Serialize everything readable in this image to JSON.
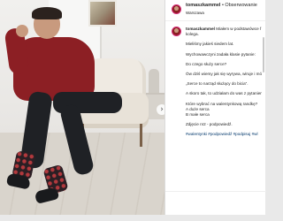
{
  "post": {
    "username": "tomaszkammel",
    "follow_label": "• Obserwowanie",
    "location": "Warszawa",
    "next_arrow": "›"
  },
  "caption": {
    "username": "tomaszkammel",
    "lines": [
      "Miałem w podstawówce f",
      "kolega.",
      "",
      "Mieliśmy jakieś siedem lat.",
      "",
      "Wychowawczyni zadała klasie pytanie:",
      "",
      "Do czego służy serce?",
      "",
      "Ów dziś wiemy jak się wyrywa, wiruje i mówi",
      "",
      "„Serce to narząd służący do bicia”.",
      "",
      "A skoro tak, to udziałam do was z pytaniem,",
      "",
      "Które wybrać na walentynkową randkę?",
      "A duże serca",
      "B małe serca",
      "",
      "Zdjęcie nr2 - podpowiedź."
    ],
    "hashtags": "#walentynki #podpowiedź #podpisuj #wl"
  }
}
